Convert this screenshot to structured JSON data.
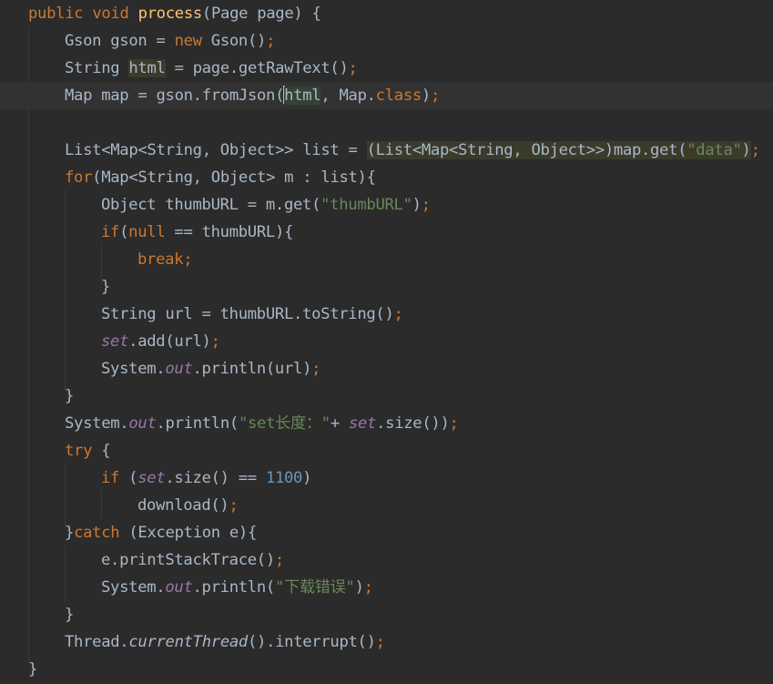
{
  "editor": {
    "language": "java",
    "theme": "Darcula",
    "colors": {
      "background": "#2b2b2b",
      "current_line": "#323232",
      "text": "#a9b7c6",
      "keyword": "#cc7832",
      "method": "#ffc66d",
      "string": "#6a8759",
      "number": "#6897bb",
      "field": "#9876aa"
    },
    "lines": [
      {
        "indent": 1,
        "tokens": [
          {
            "t": "public void ",
            "c": "kw"
          },
          {
            "t": "process",
            "c": "fn"
          },
          {
            "t": "(Page page) {"
          }
        ]
      },
      {
        "indent": 2,
        "tokens": [
          {
            "t": "Gson gson = "
          },
          {
            "t": "new ",
            "c": "kw"
          },
          {
            "t": "Gson()"
          },
          {
            "t": ";",
            "c": "semi"
          }
        ]
      },
      {
        "indent": 2,
        "tokens": [
          {
            "t": "String "
          },
          {
            "t": "html",
            "c": "warn"
          },
          {
            "t": " = page.getRawText()"
          },
          {
            "t": ";",
            "c": "semi"
          }
        ]
      },
      {
        "indent": 2,
        "current": true,
        "tokens": [
          {
            "t": "Map map = gson.fromJson("
          },
          {
            "t": "",
            "c": "caret"
          },
          {
            "t": "html",
            "c": "usage"
          },
          {
            "t": ", "
          },
          {
            "t": "Map.",
            "c": ""
          },
          {
            "t": "class",
            "c": "kw"
          },
          {
            "t": ")"
          },
          {
            "t": ";",
            "c": "semi"
          }
        ]
      },
      {
        "indent": 0,
        "tokens": []
      },
      {
        "indent": 2,
        "tokens": [
          {
            "t": "List<Map<String, Object>> list = "
          },
          {
            "t": "(List<Map<String, Object>>)map.get(",
            "c": "warn"
          },
          {
            "t": "\"data\"",
            "c": "warnstr"
          },
          {
            "t": ")",
            "c": "warn"
          },
          {
            "t": ";",
            "c": "semi"
          }
        ]
      },
      {
        "indent": 2,
        "tokens": [
          {
            "t": "for",
            "c": "kw"
          },
          {
            "t": "(Map<String, Object> m : list){"
          }
        ]
      },
      {
        "indent": 3,
        "tokens": [
          {
            "t": "Object thumbURL = m.get("
          },
          {
            "t": "\"thumbURL\"",
            "c": "str"
          },
          {
            "t": ")"
          },
          {
            "t": ";",
            "c": "semi"
          }
        ]
      },
      {
        "indent": 3,
        "tokens": [
          {
            "t": "if",
            "c": "kw"
          },
          {
            "t": "("
          },
          {
            "t": "null ",
            "c": "kw"
          },
          {
            "t": "== thumbURL){"
          }
        ]
      },
      {
        "indent": 4,
        "tokens": [
          {
            "t": "break;",
            "c": "kw"
          }
        ]
      },
      {
        "indent": 3,
        "tokens": [
          {
            "t": "}"
          }
        ]
      },
      {
        "indent": 3,
        "tokens": [
          {
            "t": "String url = thumbURL.toString()"
          },
          {
            "t": ";",
            "c": "semi"
          }
        ]
      },
      {
        "indent": 3,
        "tokens": [
          {
            "t": "set",
            "c": "field"
          },
          {
            "t": ".add(url)"
          },
          {
            "t": ";",
            "c": "semi"
          }
        ]
      },
      {
        "indent": 3,
        "tokens": [
          {
            "t": "System."
          },
          {
            "t": "out",
            "c": "field"
          },
          {
            "t": ".println(url)"
          },
          {
            "t": ";",
            "c": "semi"
          }
        ]
      },
      {
        "indent": 2,
        "tokens": [
          {
            "t": "}"
          }
        ]
      },
      {
        "indent": 2,
        "tokens": [
          {
            "t": "System."
          },
          {
            "t": "out",
            "c": "field"
          },
          {
            "t": ".println("
          },
          {
            "t": "\"set长度：\"",
            "c": "str"
          },
          {
            "t": "+ "
          },
          {
            "t": "set",
            "c": "field"
          },
          {
            "t": ".size())"
          },
          {
            "t": ";",
            "c": "semi"
          }
        ]
      },
      {
        "indent": 2,
        "tokens": [
          {
            "t": "try ",
            "c": "kw"
          },
          {
            "t": "{"
          }
        ]
      },
      {
        "indent": 3,
        "tokens": [
          {
            "t": "if ",
            "c": "kw"
          },
          {
            "t": "("
          },
          {
            "t": "set",
            "c": "field"
          },
          {
            "t": ".size() == "
          },
          {
            "t": "1100",
            "c": "num"
          },
          {
            "t": ")"
          }
        ]
      },
      {
        "indent": 4,
        "tokens": [
          {
            "t": "download()"
          },
          {
            "t": ";",
            "c": "semi"
          }
        ]
      },
      {
        "indent": 2,
        "tokens": [
          {
            "t": "}"
          },
          {
            "t": "catch ",
            "c": "kw"
          },
          {
            "t": "(Exception e){"
          }
        ]
      },
      {
        "indent": 3,
        "tokens": [
          {
            "t": "e.printStackTrace()"
          },
          {
            "t": ";",
            "c": "semi"
          }
        ]
      },
      {
        "indent": 3,
        "tokens": [
          {
            "t": "System."
          },
          {
            "t": "out",
            "c": "field"
          },
          {
            "t": ".println("
          },
          {
            "t": "\"下载错误\"",
            "c": "str"
          },
          {
            "t": ")"
          },
          {
            "t": ";",
            "c": "semi"
          }
        ]
      },
      {
        "indent": 2,
        "tokens": [
          {
            "t": "}"
          }
        ]
      },
      {
        "indent": 2,
        "tokens": [
          {
            "t": "Thread."
          },
          {
            "t": "currentThread",
            "c": "static"
          },
          {
            "t": "().interrupt()"
          },
          {
            "t": ";",
            "c": "semi"
          }
        ]
      },
      {
        "indent": 1,
        "tokens": [
          {
            "t": "}"
          }
        ]
      }
    ]
  }
}
